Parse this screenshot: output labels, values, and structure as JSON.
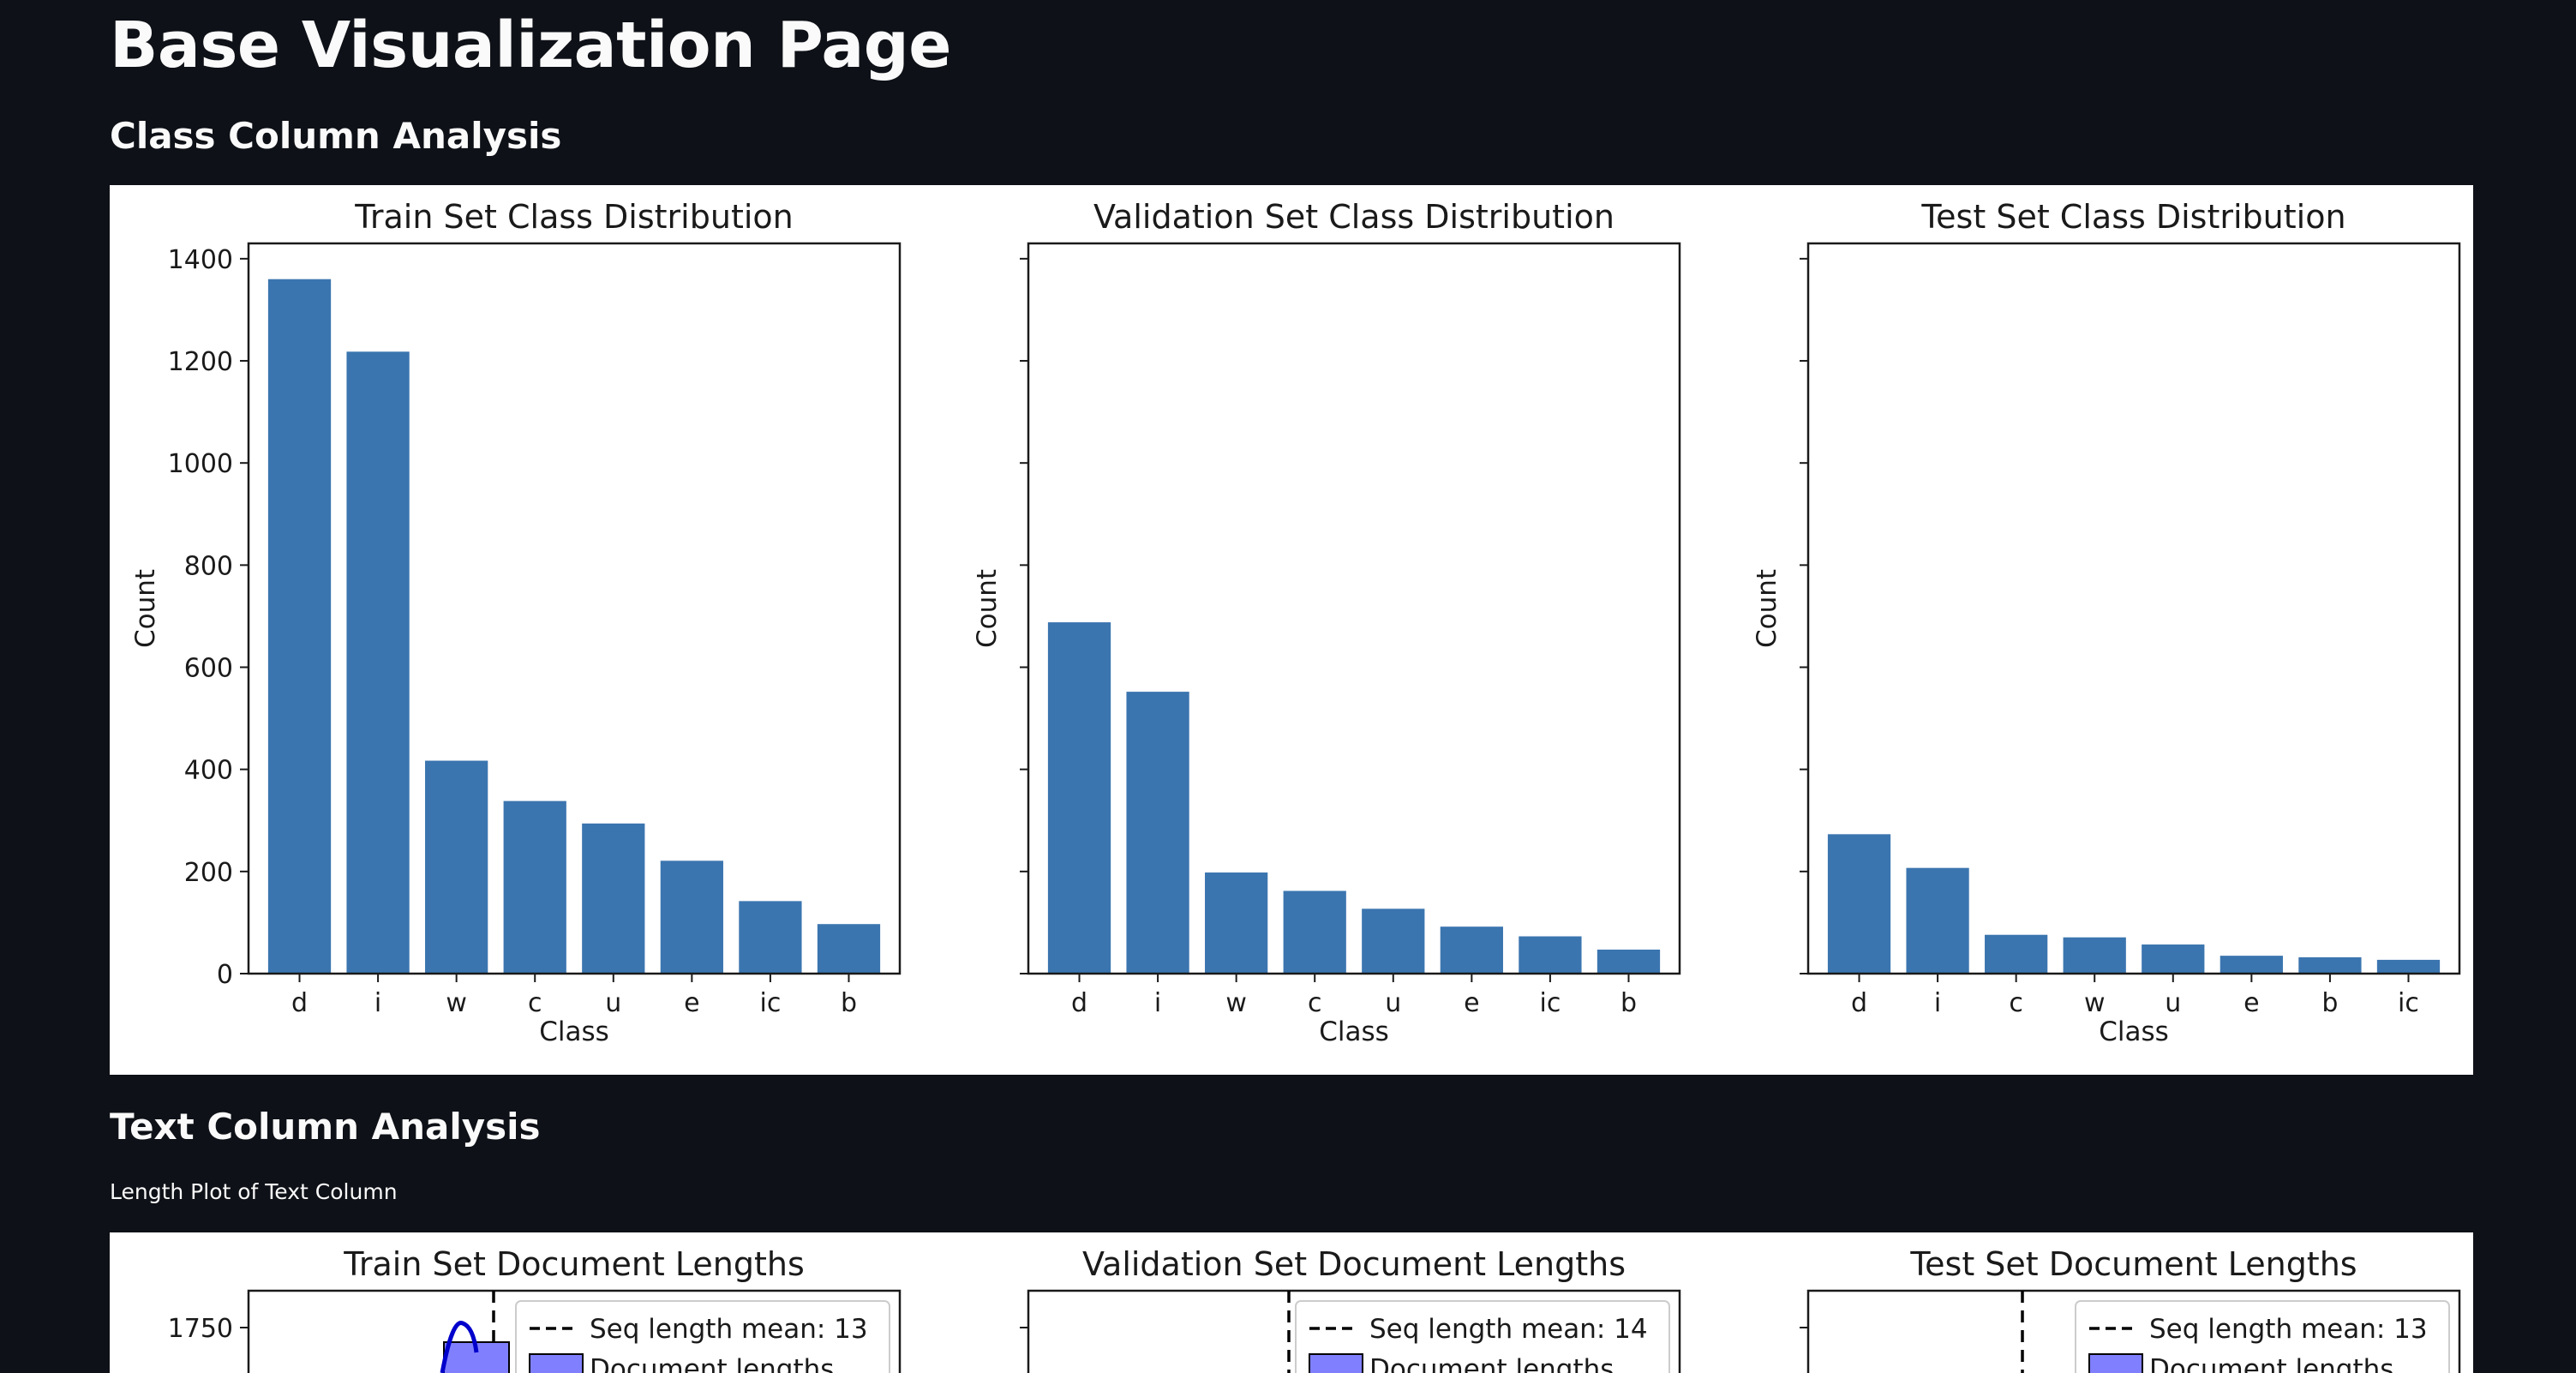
{
  "page": {
    "title": "Base Visualization Page",
    "class_section_title": "Class Column Analysis",
    "text_section_title": "Text Column Analysis",
    "text_section_caption": "Length Plot of Text Column"
  },
  "colors": {
    "bar": "#3b75af",
    "background": "#0e1117",
    "hist": "#8080ff",
    "kde": "#0000cc"
  },
  "chart_data": [
    {
      "type": "bar",
      "title": "Train Set Class Distribution",
      "xlabel": "Class",
      "ylabel": "Count",
      "categories": [
        "d",
        "i",
        "w",
        "c",
        "u",
        "e",
        "ic",
        "b"
      ],
      "values": [
        1360,
        1218,
        417,
        338,
        294,
        221,
        142,
        97
      ],
      "ylim": [
        0,
        1430
      ],
      "yticks": [
        0,
        200,
        400,
        600,
        800,
        1000,
        1200,
        1400
      ],
      "show_tick_labels": true
    },
    {
      "type": "bar",
      "title": "Validation Set Class Distribution",
      "xlabel": "Class",
      "ylabel": "Count",
      "categories": [
        "d",
        "i",
        "w",
        "c",
        "u",
        "e",
        "ic",
        "b"
      ],
      "values": [
        688,
        552,
        198,
        162,
        127,
        92,
        73,
        47
      ],
      "ylim": [
        0,
        1430
      ],
      "yticks": [
        0,
        200,
        400,
        600,
        800,
        1000,
        1200,
        1400
      ],
      "show_tick_labels": false
    },
    {
      "type": "bar",
      "title": "Test Set Class Distribution",
      "xlabel": "Class",
      "ylabel": "Count",
      "categories": [
        "d",
        "i",
        "c",
        "w",
        "u",
        "e",
        "b",
        "ic"
      ],
      "values": [
        273,
        207,
        76,
        71,
        57,
        35,
        32,
        27
      ],
      "ylim": [
        0,
        1430
      ],
      "yticks": [
        0,
        200,
        400,
        600,
        800,
        1000,
        1200,
        1400
      ],
      "show_tick_labels": false
    }
  ],
  "length_charts": [
    {
      "title": "Train Set Document Lengths",
      "mean_label": "Seq length mean: 13",
      "hist_label": "Document lengths",
      "ytick": "1750"
    },
    {
      "title": "Validation Set Document Lengths",
      "mean_label": "Seq length mean: 14",
      "hist_label": "Document lengths"
    },
    {
      "title": "Test Set Document Lengths",
      "mean_label": "Seq length mean: 13",
      "hist_label": "Document lengths"
    }
  ]
}
